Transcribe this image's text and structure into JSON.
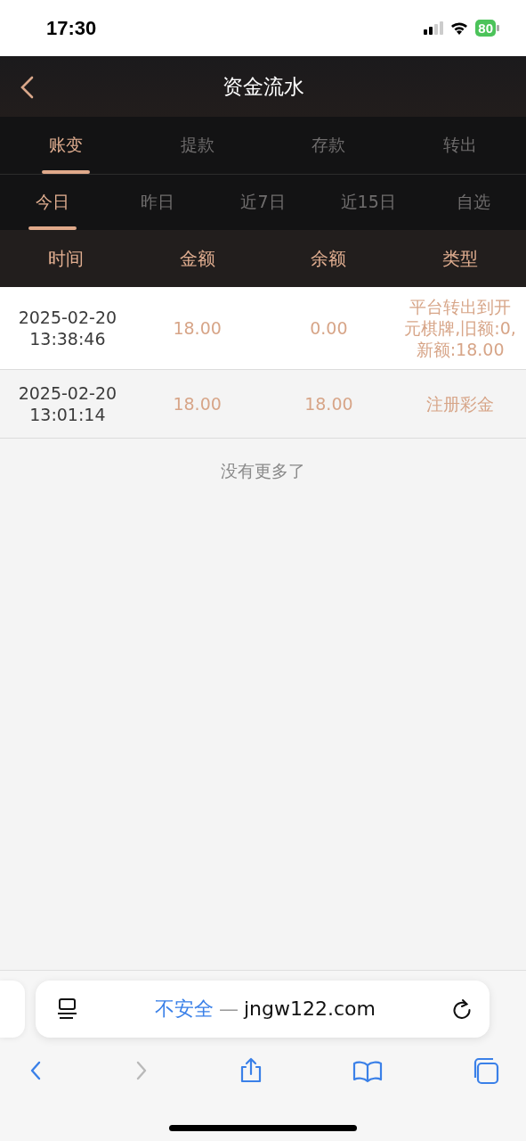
{
  "status_bar": {
    "time": "17:30",
    "battery": "80"
  },
  "header": {
    "title": "资金流水"
  },
  "tabs": [
    {
      "label": "账变",
      "selected": true
    },
    {
      "label": "提款",
      "selected": false
    },
    {
      "label": "存款",
      "selected": false
    },
    {
      "label": "转出",
      "selected": false
    }
  ],
  "date_filters": [
    {
      "label": "今日",
      "selected": true
    },
    {
      "label": "昨日",
      "selected": false
    },
    {
      "label": "近7日",
      "selected": false
    },
    {
      "label": "近15日",
      "selected": false
    },
    {
      "label": "自选",
      "selected": false
    }
  ],
  "table": {
    "columns": [
      "时间",
      "金额",
      "余额",
      "类型"
    ],
    "rows": [
      {
        "date": "2025-02-20",
        "time": "13:38:46",
        "amount": "18.00",
        "balance": "0.00",
        "type": "平台转出到开元棋牌,旧额:0,新额:18.00"
      },
      {
        "date": "2025-02-20",
        "time": "13:01:14",
        "amount": "18.00",
        "balance": "18.00",
        "type": "注册彩金"
      }
    ]
  },
  "end_note": "没有更多了",
  "browser": {
    "security": "不安全",
    "separator": "—",
    "domain": "jngw122.com",
    "toolbar": [
      {
        "kind": "back",
        "disabled": false
      },
      {
        "kind": "forward",
        "disabled": true
      },
      {
        "kind": "share",
        "disabled": false
      },
      {
        "kind": "bookmarks",
        "disabled": false
      },
      {
        "kind": "tabs",
        "disabled": false
      }
    ]
  }
}
